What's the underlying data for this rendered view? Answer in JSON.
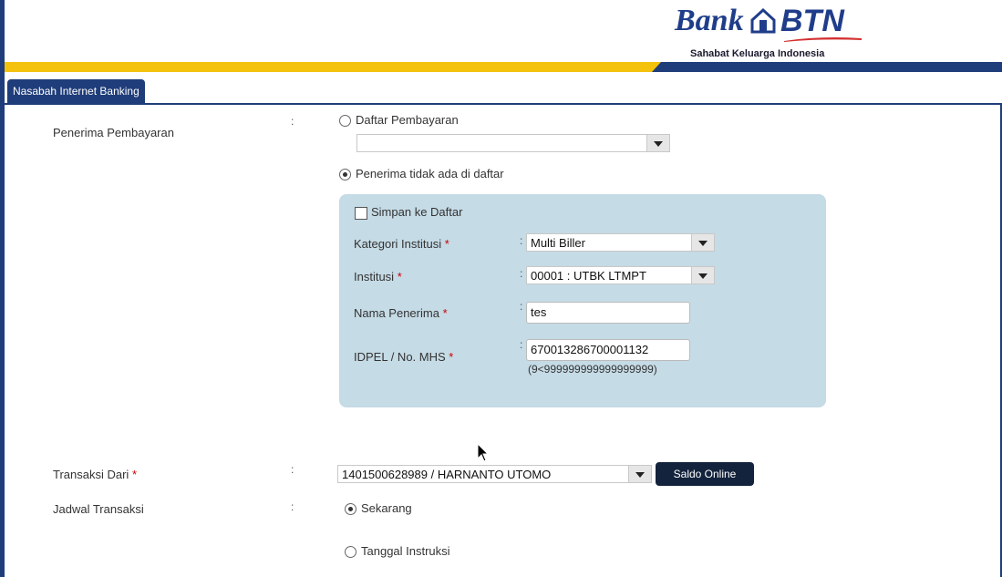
{
  "header": {
    "logo_word1": "Bank",
    "logo_word2": "BTN",
    "tagline": "Sahabat Keluarga Indonesia"
  },
  "tab": {
    "label": "Nasabah Internet Banking"
  },
  "colors": {
    "navy": "#1f3d7a",
    "yellow": "#f4c20d",
    "panel": "#c5dbe6",
    "required": "#cc0000"
  },
  "form": {
    "colon": ":",
    "required_mark": "*",
    "penerima": {
      "label": "Penerima Pembayaran",
      "option_list": "Daftar Pembayaran",
      "option_list_selected": false,
      "list_select_value": "",
      "option_not_listed": "Penerima tidak ada di daftar",
      "option_not_listed_selected": true
    },
    "panel": {
      "save_checkbox_label": "Simpan ke Daftar",
      "save_checked": false,
      "kategori": {
        "label": "Kategori Institusi",
        "value": "Multi Biller"
      },
      "institusi": {
        "label": "Institusi",
        "value": "00001 : UTBK LTMPT"
      },
      "nama": {
        "label": "Nama Penerima",
        "value": "tes"
      },
      "idpel": {
        "label": "IDPEL / No. MHS",
        "value": "670013286700001132",
        "hint": "(9<999999999999999999)"
      }
    },
    "transaksi": {
      "label": "Transaksi Dari",
      "value": "1401500628989 / HARNANTO UTOMO",
      "saldo_button": "Saldo Online"
    },
    "jadwal": {
      "label": "Jadwal Transaksi",
      "option_now": "Sekarang",
      "option_now_selected": true,
      "option_date": "Tanggal Instruksi",
      "option_date_selected": false
    }
  }
}
